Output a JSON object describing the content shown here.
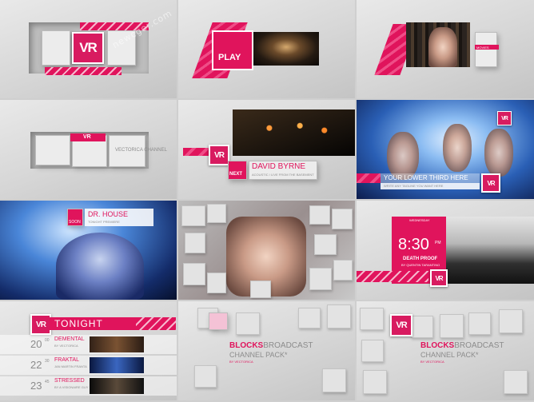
{
  "logo_text": "VR",
  "watermark": "newcger.com",
  "frames": {
    "f2": {
      "play_label": "PLAY"
    },
    "f3": {
      "tag_label": "MOVIES"
    },
    "f4": {
      "lines": [
        "VECTORICA CHANNEL"
      ]
    },
    "f5": {
      "next_label": "NEXT",
      "title": "DAVID BYRNE",
      "subtitle": "ACOUSTIC / LIVE FROM THE BASEMENT"
    },
    "f6": {
      "title": "YOUR LOWER THIRD HERE",
      "subtitle": "WRITE ANY TAGLINE YOU WANT HERE"
    },
    "f7": {
      "soon_label": "SOON",
      "title": "DR. HOUSE",
      "subtitle": "TONIGHT PREMIERE"
    },
    "f9": {
      "day": "WEDNESDAY",
      "time": "8:30",
      "ampm": "PM",
      "movie": "DEATH PROOF",
      "director": "BY QUENTIN TARANTINO"
    },
    "f10": {
      "heading": "TONIGHT",
      "rows": [
        {
          "hour": "20",
          "min": "00",
          "title": "DEMENTAL",
          "sub": "BY VECTORICA"
        },
        {
          "hour": "22",
          "min": "30",
          "title": "FRAKTAL",
          "sub": "JAN MARTIN FRANTA"
        },
        {
          "hour": "23",
          "min": "45",
          "title": "STRESSED",
          "sub": "BY A VISIONAIRE GUY"
        }
      ]
    },
    "f11": {
      "title_bold": "BLOCKS",
      "title_light": "BROADCAST",
      "title_line2": "CHANNEL PACK*",
      "by": "BY VECTORICA"
    },
    "f12": {
      "title_bold": "BLOCKS",
      "title_light": "BROADCAST",
      "title_line2": "CHANNEL PACK*",
      "by": "BY VECTORICA"
    }
  },
  "colors": {
    "accent": "#e0145c",
    "panel": "#ececec"
  }
}
